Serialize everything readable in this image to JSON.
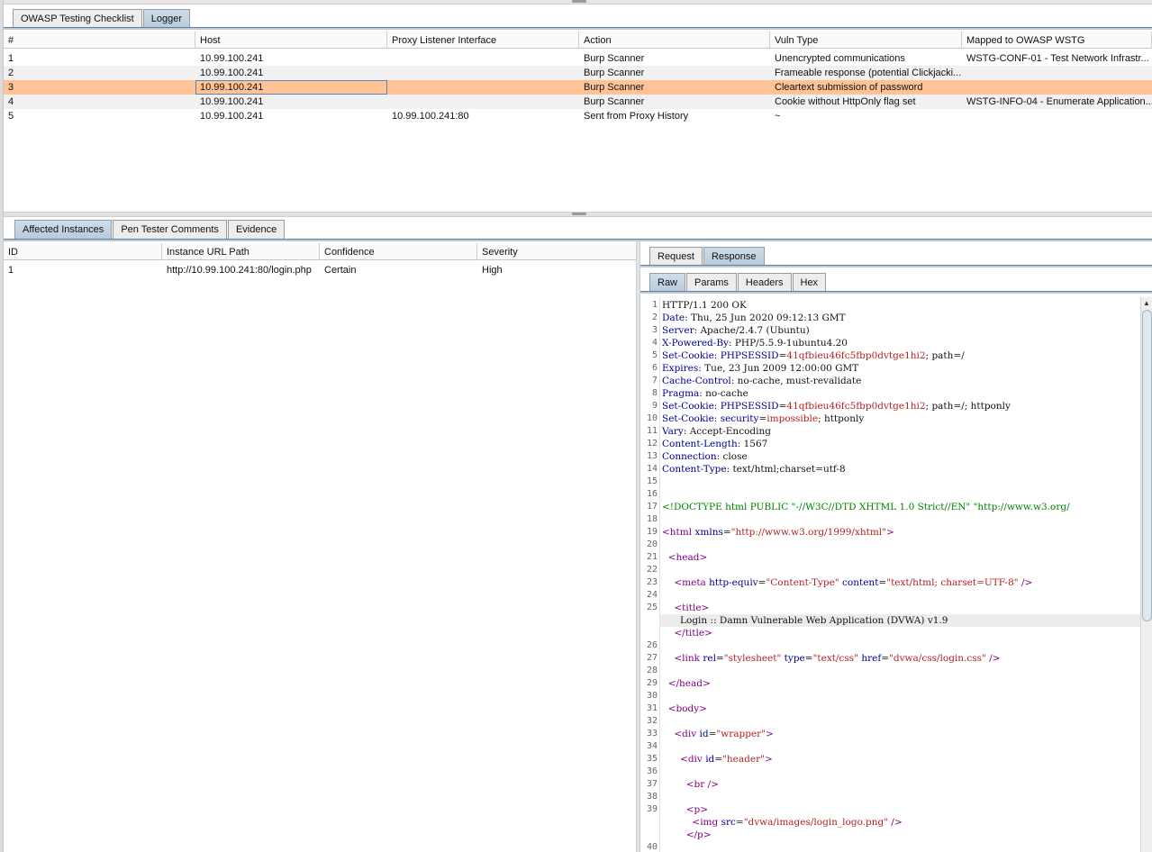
{
  "top_tabs": [
    "OWASP Testing Checklist",
    "Logger"
  ],
  "logger": {
    "columns": [
      "#",
      "Host",
      "Proxy Listener Interface",
      "Action",
      "Vuln Type",
      "Mapped to OWASP WSTG"
    ],
    "rows": [
      [
        "1",
        "10.99.100.241",
        "",
        "Burp Scanner",
        "Unencrypted communications",
        "WSTG-CONF-01 - Test Network Infrastr..."
      ],
      [
        "2",
        "10.99.100.241",
        "",
        "Burp Scanner",
        "Frameable response (potential Clickjacki...",
        ""
      ],
      [
        "3",
        "10.99.100.241",
        "",
        "Burp Scanner",
        "Cleartext submission of password",
        ""
      ],
      [
        "4",
        "10.99.100.241",
        "",
        "Burp Scanner",
        "Cookie without HttpOnly flag set",
        "WSTG-INFO-04 - Enumerate Application..."
      ],
      [
        "5",
        "10.99.100.241",
        "10.99.100.241:80",
        "Sent from Proxy History",
        "~",
        ""
      ]
    ],
    "selected_row": 3
  },
  "detail_tabs": [
    "Affected Instances",
    "Pen Tester Comments",
    "Evidence"
  ],
  "instances": {
    "columns": [
      "ID",
      "Instance URL Path",
      "Confidence",
      "Severity"
    ],
    "rows": [
      [
        "1",
        "http://10.99.100.241:80/login.php",
        "Certain",
        "High"
      ]
    ]
  },
  "message_tabs": [
    "Request",
    "Response"
  ],
  "view_tabs": [
    "Raw",
    "Params",
    "Headers",
    "Hex"
  ],
  "response_lines": [
    {
      "n": "1",
      "segs": [
        [
          "",
          "HTTP/1.1 200 OK"
        ]
      ]
    },
    {
      "n": "2",
      "segs": [
        [
          "k",
          "Date"
        ],
        [
          "",
          ": Thu, 25 Jun 2020 09:12:13 GMT"
        ]
      ]
    },
    {
      "n": "3",
      "segs": [
        [
          "k",
          "Server"
        ],
        [
          "",
          ": Apache/2.4.7 (Ubuntu)"
        ]
      ]
    },
    {
      "n": "4",
      "segs": [
        [
          "k",
          "X-Powered-By"
        ],
        [
          "",
          ": PHP/5.5.9-1ubuntu4.20"
        ]
      ]
    },
    {
      "n": "5",
      "segs": [
        [
          "k",
          "Set-Cookie"
        ],
        [
          "",
          ": "
        ],
        [
          "k",
          "PHPSESSID"
        ],
        [
          "",
          "="
        ],
        [
          "v",
          "41qfbieu46fc5fbp0dvtge1hi2"
        ],
        [
          "",
          "; path=/"
        ]
      ]
    },
    {
      "n": "6",
      "segs": [
        [
          "k",
          "Expires"
        ],
        [
          "",
          ": Tue, 23 Jun 2009 12:00:00 GMT"
        ]
      ]
    },
    {
      "n": "7",
      "segs": [
        [
          "k",
          "Cache-Control"
        ],
        [
          "",
          ": no-cache, must-revalidate"
        ]
      ]
    },
    {
      "n": "8",
      "segs": [
        [
          "k",
          "Pragma"
        ],
        [
          "",
          ": no-cache"
        ]
      ]
    },
    {
      "n": "9",
      "segs": [
        [
          "k",
          "Set-Cookie"
        ],
        [
          "",
          ": "
        ],
        [
          "k",
          "PHPSESSID"
        ],
        [
          "",
          "="
        ],
        [
          "v",
          "41qfbieu46fc5fbp0dvtge1hi2"
        ],
        [
          "",
          "; path=/; httponly"
        ]
      ]
    },
    {
      "n": "10",
      "segs": [
        [
          "k",
          "Set-Cookie"
        ],
        [
          "",
          ": "
        ],
        [
          "k",
          "security"
        ],
        [
          "",
          "="
        ],
        [
          "v",
          "impossible"
        ],
        [
          "",
          "; httponly"
        ]
      ]
    },
    {
      "n": "11",
      "segs": [
        [
          "k",
          "Vary"
        ],
        [
          "",
          ": Accept-Encoding"
        ]
      ]
    },
    {
      "n": "12",
      "segs": [
        [
          "k",
          "Content-Length"
        ],
        [
          "",
          ": 1567"
        ]
      ]
    },
    {
      "n": "13",
      "segs": [
        [
          "k",
          "Connection"
        ],
        [
          "",
          ": close"
        ]
      ]
    },
    {
      "n": "14",
      "segs": [
        [
          "k",
          "Content-Type"
        ],
        [
          "",
          ": text/html;charset=utf-8"
        ]
      ]
    },
    {
      "n": "15",
      "segs": []
    },
    {
      "n": "16",
      "segs": []
    },
    {
      "n": "17",
      "segs": [
        [
          "dt",
          "<!DOCTYPE html PUBLIC \"-//W3C//DTD XHTML 1.0 Strict//EN\" \"http://www.w3.org/"
        ]
      ]
    },
    {
      "n": "18",
      "segs": []
    },
    {
      "n": "19",
      "segs": [
        [
          "tag",
          "<html"
        ],
        [
          "",
          " "
        ],
        [
          "att",
          "xmlns"
        ],
        [
          "",
          "="
        ],
        [
          "str",
          "\"http://www.w3.org/1999/xhtml\""
        ],
        [
          "tag",
          ">"
        ]
      ]
    },
    {
      "n": "20",
      "segs": []
    },
    {
      "n": "21",
      "segs": [
        [
          "",
          "  "
        ],
        [
          "tag",
          "<head>"
        ]
      ]
    },
    {
      "n": "22",
      "segs": []
    },
    {
      "n": "23",
      "segs": [
        [
          "",
          "    "
        ],
        [
          "tag",
          "<meta"
        ],
        [
          "",
          " "
        ],
        [
          "att",
          "http-equiv"
        ],
        [
          "",
          "="
        ],
        [
          "str",
          "\"Content-Type\""
        ],
        [
          "",
          " "
        ],
        [
          "att",
          "content"
        ],
        [
          "",
          "="
        ],
        [
          "str",
          "\"text/html; charset=UTF-8\""
        ],
        [
          "tag",
          " />"
        ]
      ]
    },
    {
      "n": "24",
      "segs": []
    },
    {
      "n": "25",
      "segs": [
        [
          "",
          "    "
        ],
        [
          "tag",
          "<title>"
        ]
      ]
    },
    {
      "n": "",
      "segs": [
        [
          "",
          "      Login :: Damn Vulnerable Web Application (DVWA) v1.9"
        ]
      ]
    },
    {
      "n": "",
      "segs": [
        [
          "",
          "    "
        ],
        [
          "tag",
          "</title>"
        ]
      ]
    },
    {
      "n": "26",
      "segs": []
    },
    {
      "n": "27",
      "segs": [
        [
          "",
          "    "
        ],
        [
          "tag",
          "<link"
        ],
        [
          "",
          " "
        ],
        [
          "att",
          "rel"
        ],
        [
          "",
          "="
        ],
        [
          "str",
          "\"stylesheet\""
        ],
        [
          "",
          " "
        ],
        [
          "att",
          "type"
        ],
        [
          "",
          "="
        ],
        [
          "str",
          "\"text/css\""
        ],
        [
          "",
          " "
        ],
        [
          "att",
          "href"
        ],
        [
          "",
          "="
        ],
        [
          "str",
          "\"dvwa/css/login.css\""
        ],
        [
          "tag",
          " />"
        ]
      ]
    },
    {
      "n": "28",
      "segs": []
    },
    {
      "n": "29",
      "segs": [
        [
          "",
          "  "
        ],
        [
          "tag",
          "</head>"
        ]
      ]
    },
    {
      "n": "30",
      "segs": []
    },
    {
      "n": "31",
      "segs": [
        [
          "",
          "  "
        ],
        [
          "tag",
          "<body>"
        ]
      ]
    },
    {
      "n": "32",
      "segs": []
    },
    {
      "n": "33",
      "segs": [
        [
          "",
          "    "
        ],
        [
          "tag",
          "<div"
        ],
        [
          "",
          " "
        ],
        [
          "att",
          "id"
        ],
        [
          "",
          "="
        ],
        [
          "str",
          "\"wrapper\""
        ],
        [
          "tag",
          ">"
        ]
      ]
    },
    {
      "n": "34",
      "segs": []
    },
    {
      "n": "35",
      "segs": [
        [
          "",
          "      "
        ],
        [
          "tag",
          "<div"
        ],
        [
          "",
          " "
        ],
        [
          "att",
          "id"
        ],
        [
          "",
          "="
        ],
        [
          "str",
          "\"header\""
        ],
        [
          "tag",
          ">"
        ]
      ]
    },
    {
      "n": "36",
      "segs": []
    },
    {
      "n": "37",
      "segs": [
        [
          "",
          "        "
        ],
        [
          "tag",
          "<br"
        ],
        [
          "tag",
          " />"
        ]
      ]
    },
    {
      "n": "38",
      "segs": []
    },
    {
      "n": "39",
      "segs": [
        [
          "",
          "        "
        ],
        [
          "tag",
          "<p>"
        ]
      ]
    },
    {
      "n": "",
      "segs": [
        [
          "",
          "          "
        ],
        [
          "tag",
          "<img"
        ],
        [
          "",
          " "
        ],
        [
          "att",
          "src"
        ],
        [
          "",
          "="
        ],
        [
          "str",
          "\"dvwa/images/login_logo.png\""
        ],
        [
          "tag",
          " />"
        ]
      ]
    },
    {
      "n": "",
      "segs": [
        [
          "",
          "        "
        ],
        [
          "tag",
          "</p>"
        ]
      ]
    },
    {
      "n": "40",
      "segs": []
    }
  ],
  "current_line_index": 25
}
